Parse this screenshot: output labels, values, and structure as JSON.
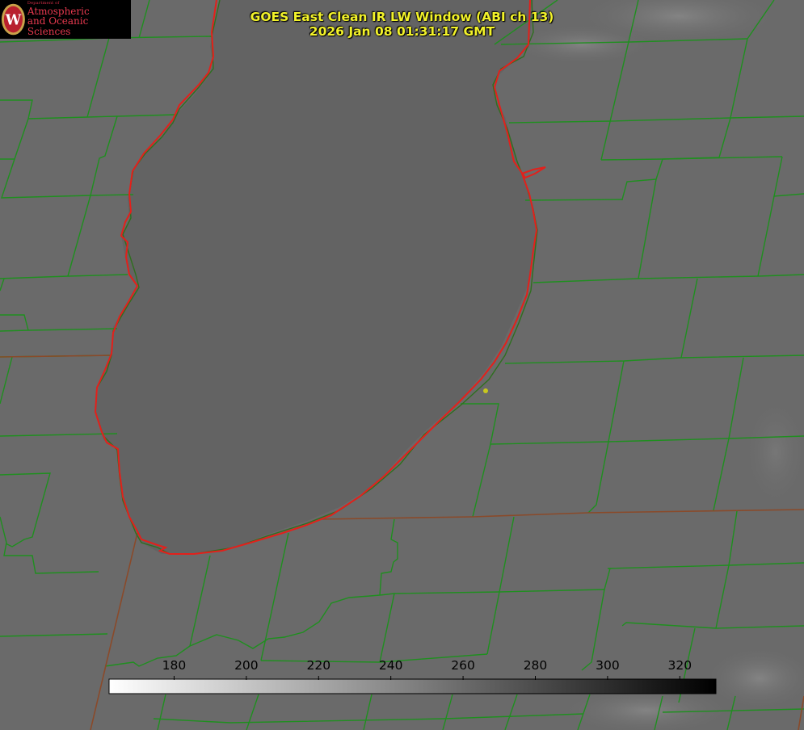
{
  "logo": {
    "department": "Department of",
    "line1": "Atmospheric",
    "line2": "and Oceanic Sciences",
    "seal_letter": "W",
    "seal_color": "#b8202e"
  },
  "title": {
    "line1": "GOES East Clean IR LW Window (ABI ch 13)",
    "line2": "2026 Jan 08 01:31:17 GMT"
  },
  "colorbar": {
    "tick_values": [
      "180",
      "200",
      "220",
      "240",
      "260",
      "280",
      "300",
      "320"
    ],
    "range": [
      162,
      330
    ],
    "gradient_start": "#ffffff",
    "gradient_end": "#000000"
  },
  "colors": {
    "background_gray": "#6a6a6a",
    "lake_gray": "#636363",
    "boundary_green": "#1f8f1f",
    "coastline_red": "#e3201b",
    "state_line": "#8a4a2a",
    "title_yellow": "#f2f22a",
    "marker_yellow": "#c8c81e"
  }
}
